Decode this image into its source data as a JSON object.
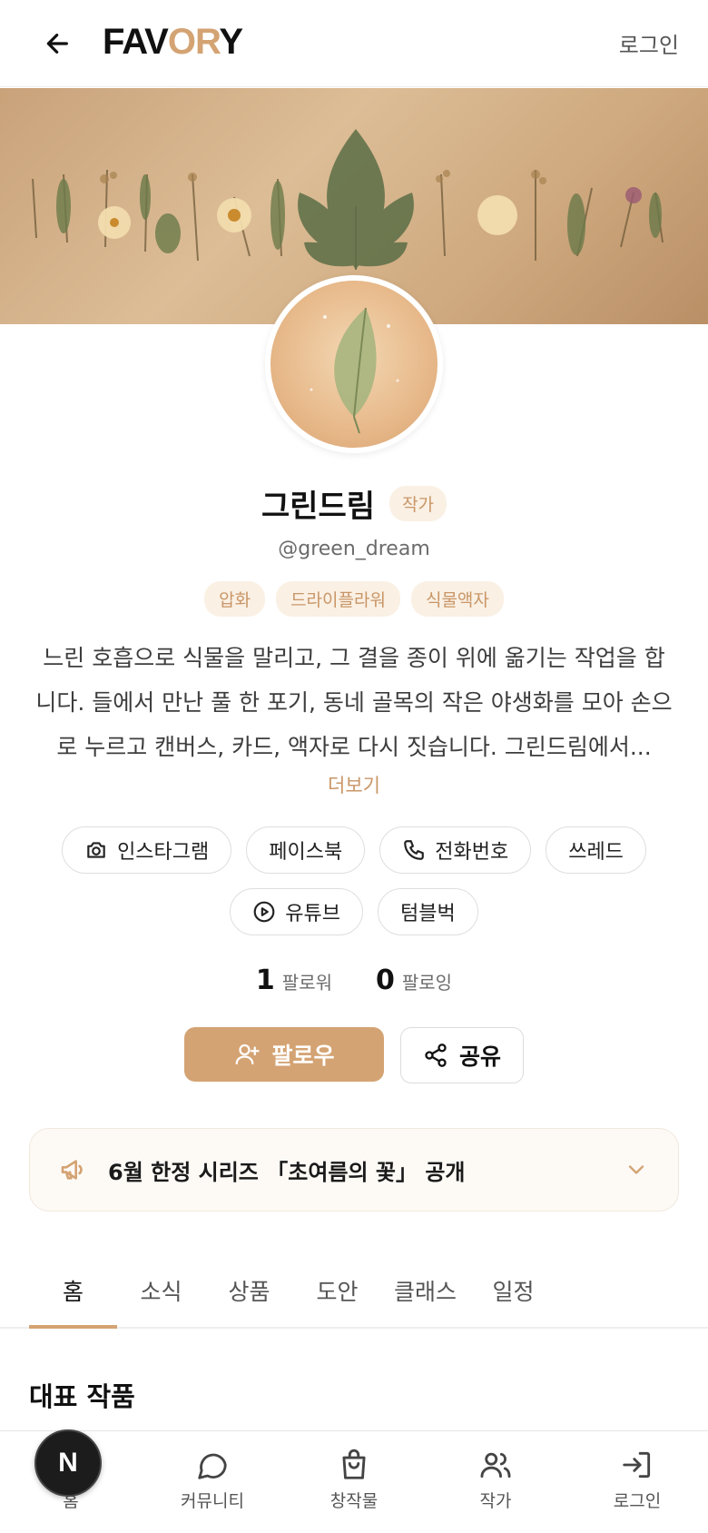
{
  "header": {
    "logo_prefix": "FAV",
    "logo_accent": "OR",
    "logo_suffix": "Y",
    "login_label": "로그인"
  },
  "profile": {
    "name": "그린드림",
    "role": "작가",
    "handle": "@green_dream",
    "tags": [
      "압화",
      "드라이플라워",
      "식물액자"
    ],
    "bio": "느린 호흡으로 식물을 말리고, 그 결을 종이 위에 옮기는 작업을 합니다. 들에서 만난 풀 한 포기, 동네 골목의 작은 야생화를 모아 손으로 누르고 캔버스, 카드, 액자로 다시 짓습니다. 그린드림에서...",
    "more_label": "더보기"
  },
  "socials": [
    {
      "label": "인스타그램",
      "icon": "camera-icon"
    },
    {
      "label": "페이스북",
      "icon": ""
    },
    {
      "label": "전화번호",
      "icon": "phone-icon"
    },
    {
      "label": "쓰레드",
      "icon": ""
    },
    {
      "label": "유튜브",
      "icon": "play-icon"
    },
    {
      "label": "텀블벅",
      "icon": ""
    }
  ],
  "stats": {
    "followers_count": "1",
    "followers_label": "팔로워",
    "following_count": "0",
    "following_label": "팔로잉"
  },
  "actions": {
    "follow_label": "팔로우",
    "share_label": "공유"
  },
  "notice": {
    "text": "6월 한정 시리즈 「초여름의 꽃」 공개"
  },
  "tabs": [
    "홈",
    "소식",
    "상품",
    "도안",
    "클래스",
    "일정"
  ],
  "section": {
    "title": "대표 작품"
  },
  "bottom_nav": [
    {
      "label": "홈",
      "icon": "home-icon"
    },
    {
      "label": "커뮤니티",
      "icon": "chat-bubble-icon"
    },
    {
      "label": "창작물",
      "icon": "shopping-bag-icon"
    },
    {
      "label": "작가",
      "icon": "users-icon"
    },
    {
      "label": "로그인",
      "icon": "login-icon"
    }
  ],
  "fab_label": "N",
  "colors": {
    "accent": "#d4a373",
    "tag_bg": "#faf0e4",
    "tag_text": "#c99667"
  }
}
